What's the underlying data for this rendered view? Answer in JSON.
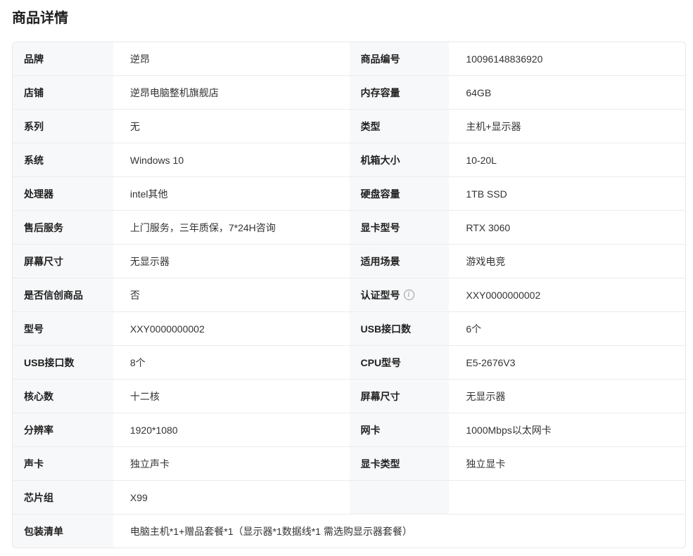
{
  "title": "商品详情",
  "rows": [
    {
      "k1": "品牌",
      "v1": "逆昂",
      "k2": "商品编号",
      "v2": "10096148836920"
    },
    {
      "k1": "店铺",
      "v1": "逆昂电脑整机旗舰店",
      "k2": "内存容量",
      "v2": "64GB"
    },
    {
      "k1": "系列",
      "v1": "无",
      "k2": "类型",
      "v2": "主机+显示器"
    },
    {
      "k1": "系统",
      "v1": "Windows 10",
      "k2": "机箱大小",
      "v2": "10-20L"
    },
    {
      "k1": "处理器",
      "v1": "intel其他",
      "k2": "硬盘容量",
      "v2": "1TB SSD"
    },
    {
      "k1": "售后服务",
      "v1": "上门服务，三年质保，7*24H咨询",
      "k2": "显卡型号",
      "v2": "RTX 3060"
    },
    {
      "k1": "屏幕尺寸",
      "v1": "无显示器",
      "k2": "适用场景",
      "v2": "游戏电竞"
    },
    {
      "k1": "是否信创商品",
      "v1": "否",
      "k2": "认证型号",
      "v2": "XXY0000000002"
    },
    {
      "k1": "型号",
      "v1": "XXY0000000002",
      "k2": "USB接口数",
      "v2": "6个"
    },
    {
      "k1": "USB接口数",
      "v1": "8个",
      "k2": "CPU型号",
      "v2": "E5-2676V3"
    },
    {
      "k1": "核心数",
      "v1": "十二核",
      "k2": "屏幕尺寸",
      "v2": "无显示器"
    },
    {
      "k1": "分辨率",
      "v1": "1920*1080",
      "k2": "网卡",
      "v2": "1000Mbps以太网卡"
    },
    {
      "k1": "声卡",
      "v1": "独立声卡",
      "k2": "显卡类型",
      "v2": "独立显卡"
    }
  ],
  "chipset": {
    "k": "芯片组",
    "v": "X99"
  },
  "package": {
    "k": "包装清单",
    "v": "电脑主机*1+赠品套餐*1（显示器*1数据线*1 需选购显示器套餐）"
  },
  "info_icon": "info-icon"
}
